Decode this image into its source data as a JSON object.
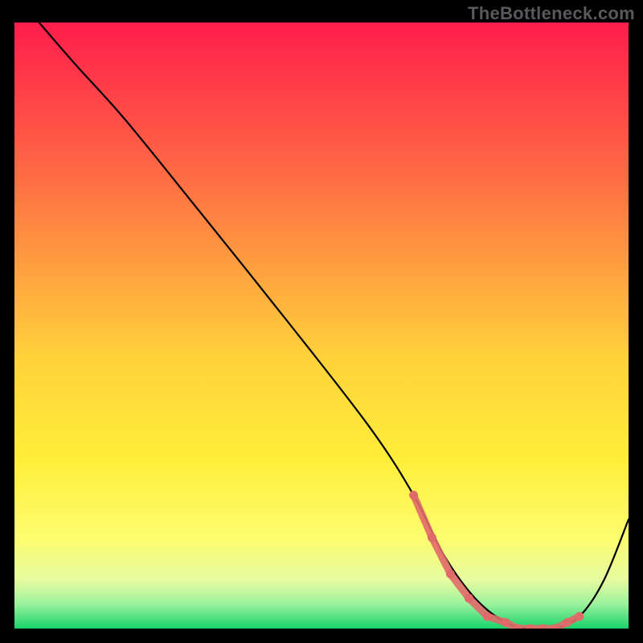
{
  "watermark": "TheBottleneck.com",
  "chart_data": {
    "type": "line",
    "title": "",
    "xlabel": "",
    "ylabel": "",
    "xlim": [
      0,
      100
    ],
    "ylim": [
      0,
      100
    ],
    "grid": false,
    "legend": false,
    "background_gradient": {
      "stops": [
        {
          "offset": 0.0,
          "color": "#ff1d4b"
        },
        {
          "offset": 0.2,
          "color": "#ff5a46"
        },
        {
          "offset": 0.38,
          "color": "#ff9740"
        },
        {
          "offset": 0.55,
          "color": "#ffd13a"
        },
        {
          "offset": 0.72,
          "color": "#ffee3a"
        },
        {
          "offset": 0.85,
          "color": "#fdfd6e"
        },
        {
          "offset": 0.92,
          "color": "#e7fba0"
        },
        {
          "offset": 0.96,
          "color": "#9af29c"
        },
        {
          "offset": 1.0,
          "color": "#17d36a"
        }
      ]
    },
    "series": [
      {
        "name": "main-curve",
        "color": "#000000",
        "x": [
          4,
          10,
          18,
          30,
          45,
          58,
          65,
          70,
          75,
          80,
          84,
          88,
          92,
          96,
          100
        ],
        "values": [
          100,
          93,
          84,
          69,
          50,
          33,
          22,
          12,
          5,
          1,
          0,
          0,
          2,
          8,
          18
        ]
      }
    ],
    "highlight": {
      "name": "valley-highlight",
      "color": "#e06969",
      "x": [
        65,
        68,
        71,
        74,
        77,
        80,
        82,
        84,
        86,
        88,
        90,
        92
      ],
      "values": [
        22,
        15,
        9,
        5,
        2,
        1,
        0,
        0,
        0,
        0,
        1,
        2
      ]
    }
  }
}
